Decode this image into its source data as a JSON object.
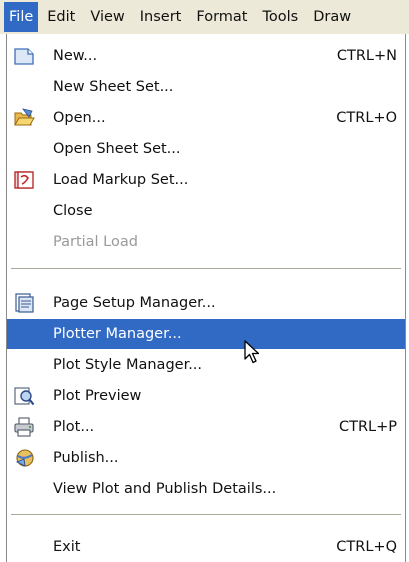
{
  "menubar": {
    "items": [
      {
        "label": "File"
      },
      {
        "label": "Edit"
      },
      {
        "label": "View"
      },
      {
        "label": "Insert"
      },
      {
        "label": "Format"
      },
      {
        "label": "Tools"
      },
      {
        "label": "Draw"
      }
    ],
    "active": "File"
  },
  "file_menu": {
    "new": {
      "label": "New...",
      "shortcut": "CTRL+N",
      "icon": "new-document-icon"
    },
    "new_sheet_set": {
      "label": "New Sheet Set..."
    },
    "open": {
      "label": "Open...",
      "shortcut": "CTRL+O",
      "icon": "open-folder-icon"
    },
    "open_sheet_set": {
      "label": "Open Sheet Set..."
    },
    "load_markup_set": {
      "label": "Load Markup Set...",
      "icon": "markup-set-icon"
    },
    "close": {
      "label": "Close"
    },
    "partial_load": {
      "label": "Partial Load",
      "disabled": true
    },
    "page_setup_manager": {
      "label": "Page Setup Manager...",
      "icon": "page-setup-icon"
    },
    "plotter_manager": {
      "label": "Plotter Manager...",
      "highlighted": true
    },
    "plot_style_manager": {
      "label": "Plot Style Manager..."
    },
    "plot_preview": {
      "label": "Plot Preview",
      "icon": "plot-preview-icon"
    },
    "plot": {
      "label": "Plot...",
      "shortcut": "CTRL+P",
      "icon": "printer-icon"
    },
    "publish": {
      "label": "Publish...",
      "icon": "publish-icon"
    },
    "view_plot_publish_details": {
      "label": "View Plot and Publish Details..."
    },
    "exit": {
      "label": "Exit",
      "shortcut": "CTRL+Q"
    }
  },
  "colors": {
    "menubar_bg": "#ece9d8",
    "highlight": "#316ac5",
    "disabled_text": "#9a9a9a",
    "separator": "#aca899"
  }
}
